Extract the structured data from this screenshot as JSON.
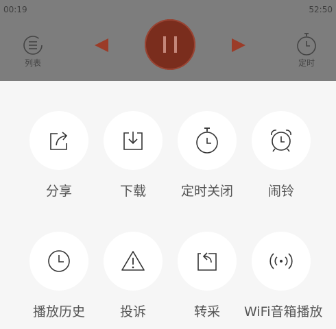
{
  "player": {
    "elapsed": "00:19",
    "duration": "52:50",
    "playlist_label": "列表",
    "timer_label": "定时",
    "state": "playing",
    "accent_color": "#7a2d1d",
    "arrow_color": "#9b3c28"
  },
  "actions": {
    "row1": [
      {
        "label": "分享",
        "icon": "share-icon"
      },
      {
        "label": "下载",
        "icon": "download-icon"
      },
      {
        "label": "定时关闭",
        "icon": "timer-icon"
      },
      {
        "label": "闹铃",
        "icon": "alarm-clock-icon"
      }
    ],
    "row2": [
      {
        "label": "播放历史",
        "icon": "history-clock-icon"
      },
      {
        "label": "投诉",
        "icon": "warning-icon"
      },
      {
        "label": "转采",
        "icon": "repost-icon"
      },
      {
        "label": "WiFi音箱播放",
        "icon": "wifi-speaker-icon"
      }
    ]
  }
}
